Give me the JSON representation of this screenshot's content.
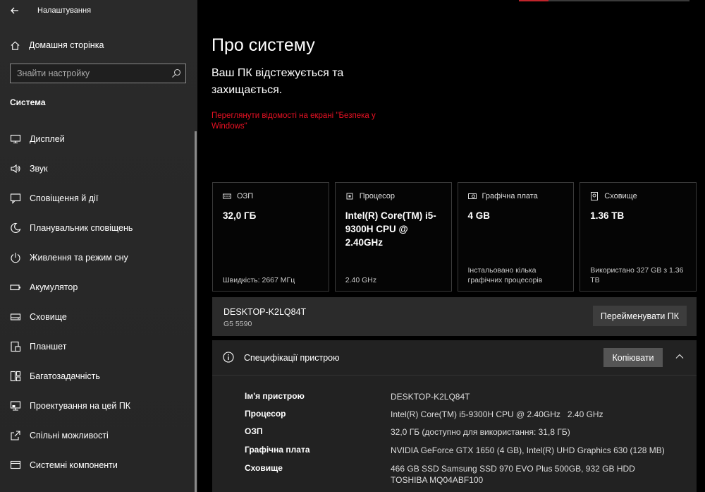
{
  "sidebar": {
    "app_title": "Налаштування",
    "home_label": "Домашня сторінка",
    "search_placeholder": "Знайти настройку",
    "section_title": "Система",
    "items": [
      {
        "label": "Дисплей",
        "icon": "display-icon"
      },
      {
        "label": "Звук",
        "icon": "speaker-icon"
      },
      {
        "label": "Сповіщення й дії",
        "icon": "notification-icon"
      },
      {
        "label": "Планувальник сповіщень",
        "icon": "moon-icon"
      },
      {
        "label": "Живлення та режим сну",
        "icon": "power-icon"
      },
      {
        "label": "Акумулятор",
        "icon": "battery-icon"
      },
      {
        "label": "Сховище",
        "icon": "storage-icon"
      },
      {
        "label": "Планшет",
        "icon": "tablet-icon"
      },
      {
        "label": "Багатозадачність",
        "icon": "multitask-icon"
      },
      {
        "label": "Проектування на цей ПК",
        "icon": "projection-icon"
      },
      {
        "label": "Спільні можливості",
        "icon": "shared-icon"
      },
      {
        "label": "Системні компоненти",
        "icon": "components-icon"
      }
    ]
  },
  "main": {
    "title": "Про систему",
    "status_text": "Ваш ПК відстежується та захищається.",
    "security_link": "Переглянути відомості на екрані \"Безпека у Windows\"",
    "cards": [
      {
        "title": "ОЗП",
        "value": "32,0 ГБ",
        "footer": "Швидкість: 2667 МГц",
        "icon": "ram-icon"
      },
      {
        "title": "Процесор",
        "value": "Intel(R) Core(TM) i5-9300H CPU @ 2.40GHz",
        "footer": "2.40 GHz",
        "icon": "cpu-icon"
      },
      {
        "title": "Графічна плата",
        "value": "4 GB",
        "footer": "Інстальовано кілька графічних процесорів",
        "icon": "gpu-icon"
      },
      {
        "title": "Сховище",
        "value": "1.36 TB",
        "footer": "Використано 327 GB з 1.36 TB",
        "icon": "disk-icon"
      }
    ],
    "pc": {
      "name": "DESKTOP-K2LQ84T",
      "model": "G5 5590",
      "rename_label": "Перейменувати ПК"
    },
    "specs": {
      "title": "Специфікації пристрою",
      "copy_label": "Копіювати",
      "rows": [
        {
          "key": "Ім'я пристрою",
          "value": "DESKTOP-K2LQ84T"
        },
        {
          "key": "Процесор",
          "value": "Intel(R) Core(TM) i5-9300H CPU @ 2.40GHz   2.40 GHz"
        },
        {
          "key": "ОЗП",
          "value": "32,0 ГБ (доступно для використання: 31,8 ГБ)"
        },
        {
          "key": "Графічна плата",
          "value": "NVIDIA GeForce GTX 1650 (4 GB), Intel(R) UHD Graphics 630 (128 MB)"
        },
        {
          "key": "Сховище",
          "value": "466 GB SSD Samsung SSD 970 EVO Plus 500GB, 932 GB HDD TOSHIBA MQ04ABF100"
        }
      ]
    }
  },
  "colors": {
    "accent_link": "#e81123",
    "sidebar_bg": "#2a2a2a",
    "panel_bg": "#222222"
  }
}
